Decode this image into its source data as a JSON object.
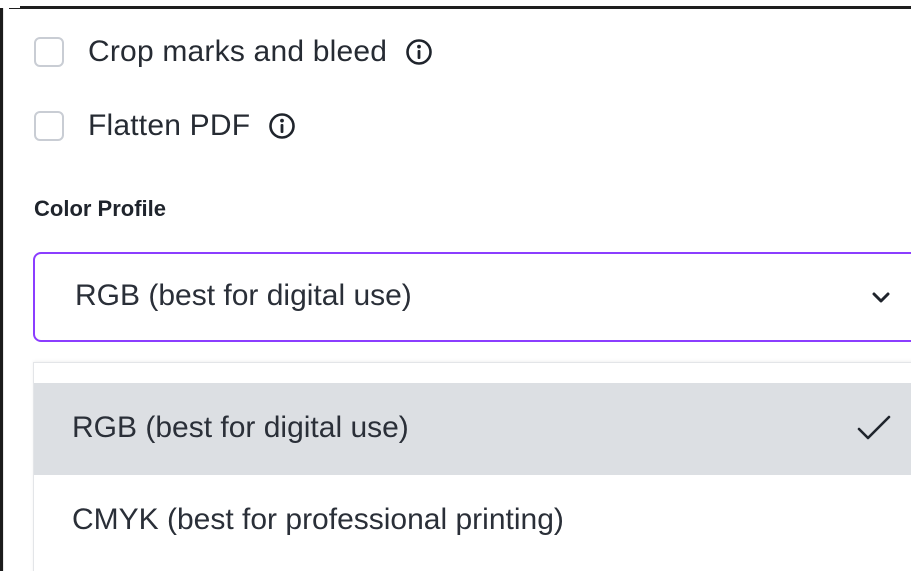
{
  "options": {
    "crop_marks": {
      "label": "Crop marks and bleed",
      "checked": false,
      "icon": "info-icon"
    },
    "flatten_pdf": {
      "label": "Flatten PDF",
      "checked": false,
      "icon": "info-icon"
    }
  },
  "color_profile": {
    "title": "Color Profile",
    "selected_value": "RGB (best for digital use)",
    "dropdown_icon": "chevron-down-icon",
    "accent_color": "#8b3dff",
    "menu": {
      "items": [
        {
          "label": "RGB (best for digital use)",
          "selected": true,
          "icon": "check-icon"
        },
        {
          "label": "CMYK (best for professional printing)",
          "selected": false
        }
      ]
    }
  }
}
